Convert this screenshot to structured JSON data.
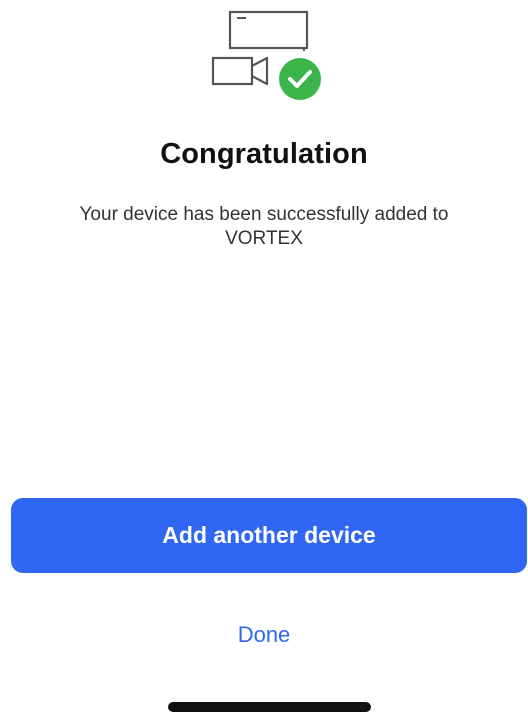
{
  "hero": {
    "icon": "device-added-success-icon",
    "check_color": "#3bb54a"
  },
  "title": "Congratulation",
  "message": "Your device has been successfully added to VORTEX",
  "actions": {
    "primary_label": "Add another device",
    "secondary_label": "Done"
  },
  "colors": {
    "accent": "#2f66f3",
    "success": "#3bb54a"
  }
}
